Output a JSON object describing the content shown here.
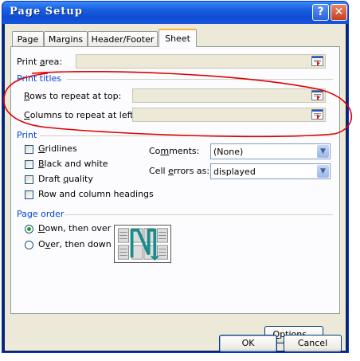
{
  "window": {
    "title": "Page Setup",
    "help_label": "?",
    "close_label": "✕"
  },
  "tabs": [
    {
      "label": "Page"
    },
    {
      "label": "Margins"
    },
    {
      "label": "Header/Footer"
    },
    {
      "label": "Sheet",
      "active": true
    }
  ],
  "print_area": {
    "pre": "Print ",
    "key": "a",
    "post": "rea:",
    "value": ""
  },
  "print_titles": {
    "heading": "Print titles",
    "rows": {
      "key": "R",
      "post": "ows to repeat at top:",
      "value": ""
    },
    "columns": {
      "key": "C",
      "post": "olumns to repeat at left:",
      "value": ""
    }
  },
  "print": {
    "heading": "Print",
    "gridlines": {
      "key": "G",
      "post": "ridlines",
      "checked": false
    },
    "black_white": {
      "key": "B",
      "post": "lack and white",
      "checked": false
    },
    "draft": {
      "pre": "Draft ",
      "key": "q",
      "post": "uality",
      "checked": false
    },
    "headings": {
      "pre": "Row and column h",
      "key": "",
      "post": "eadings",
      "checked": false
    },
    "comments": {
      "pre": "Co",
      "key": "m",
      "post": "ments:",
      "value": "(None)"
    },
    "cell_errors": {
      "pre": "Cell ",
      "key": "e",
      "post": "rrors as:",
      "value": "displayed"
    }
  },
  "page_order": {
    "heading": "Page order",
    "down_then_over": {
      "key": "D",
      "post": "own, then over",
      "selected": true
    },
    "over_then_down": {
      "pre": "O",
      "key": "v",
      "post": "er, then down",
      "selected": false
    }
  },
  "buttons": {
    "options": {
      "key": "O",
      "post": "ptions..."
    },
    "ok": "OK",
    "cancel": "Cancel"
  },
  "colors": {
    "section": "#0046d5",
    "annotation": "#e00000"
  }
}
